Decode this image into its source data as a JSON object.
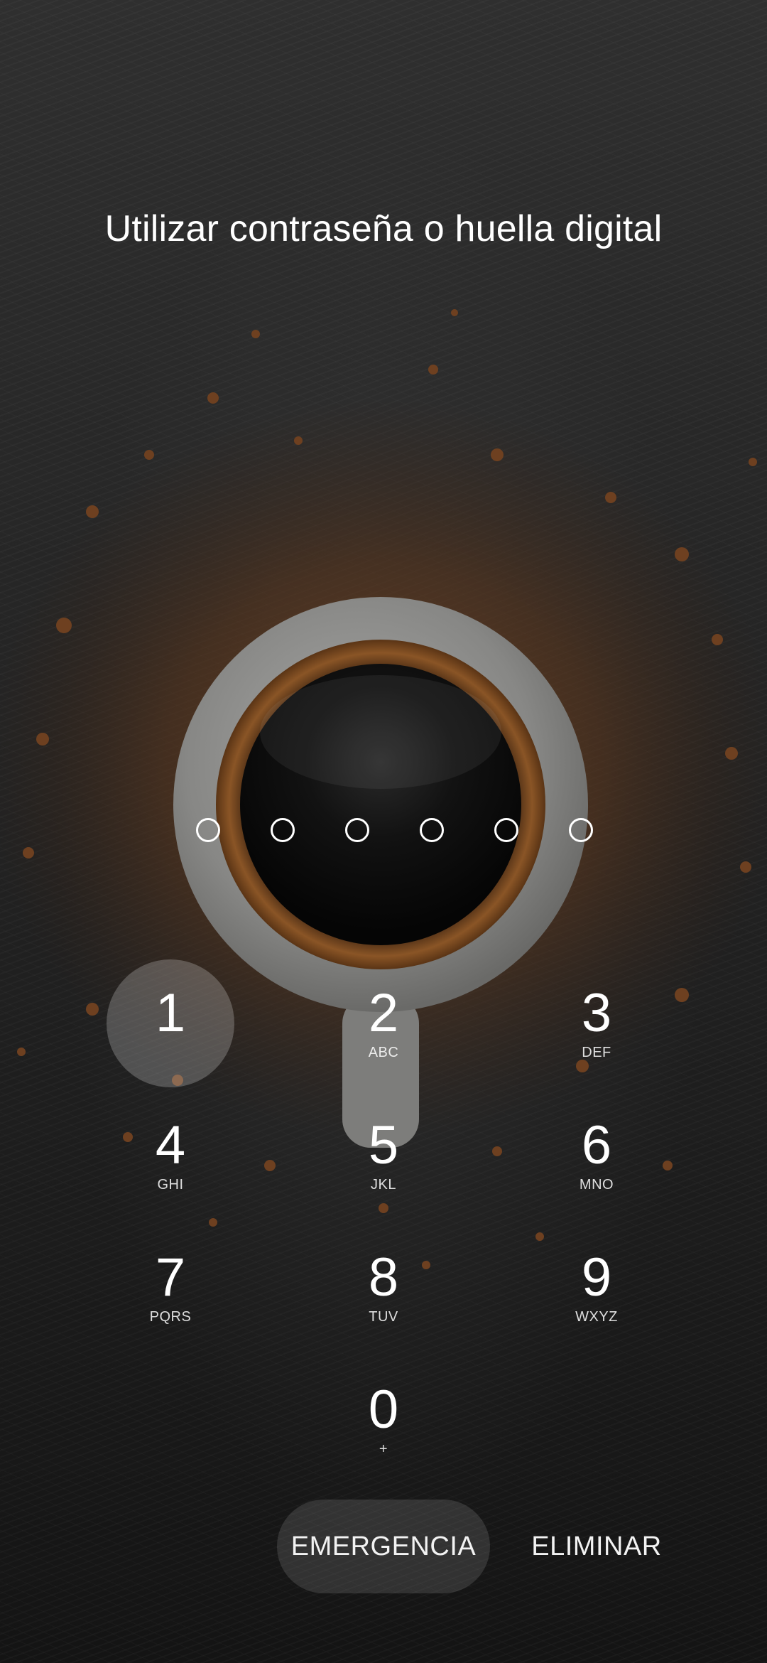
{
  "lockscreen": {
    "title": "Utilizar contraseña o huella digital",
    "pin_slots": 6,
    "keypad": {
      "keys": [
        {
          "digit": "1",
          "letters": ""
        },
        {
          "digit": "2",
          "letters": "ABC"
        },
        {
          "digit": "3",
          "letters": "DEF"
        },
        {
          "digit": "4",
          "letters": "GHI"
        },
        {
          "digit": "5",
          "letters": "JKL"
        },
        {
          "digit": "6",
          "letters": "MNO"
        },
        {
          "digit": "7",
          "letters": "PQRS"
        },
        {
          "digit": "8",
          "letters": "TUV"
        },
        {
          "digit": "9",
          "letters": "WXYZ"
        },
        {
          "digit": "0",
          "letters": "+"
        }
      ],
      "pressed_key": "1"
    },
    "emergency_label": "EMERGENCIA",
    "delete_label": "ELIMINAR"
  },
  "wallpaper": {
    "subject": "coffee-cup-with-grounds",
    "colors": {
      "background": "#262626",
      "cup": "#8a8a88",
      "coffee": "#0d0d0d",
      "crema": "#7a4a22",
      "grounds": "#6b3f1f"
    }
  }
}
